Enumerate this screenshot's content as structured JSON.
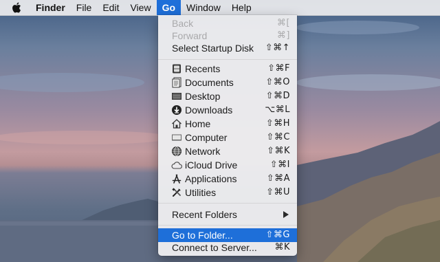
{
  "menubar": {
    "app_name": "Finder",
    "items": [
      "File",
      "Edit",
      "View",
      "Go",
      "Window",
      "Help"
    ],
    "active_item": "Go"
  },
  "go_menu": {
    "back": {
      "label": "Back",
      "shortcut": "⌘["
    },
    "forward": {
      "label": "Forward",
      "shortcut": "⌘]"
    },
    "startup": {
      "label": "Select Startup Disk",
      "shortcut": "⇧⌘↑"
    },
    "locations": [
      {
        "label": "Recents",
        "shortcut": "⇧⌘F",
        "icon": "recents-icon"
      },
      {
        "label": "Documents",
        "shortcut": "⇧⌘O",
        "icon": "documents-icon"
      },
      {
        "label": "Desktop",
        "shortcut": "⇧⌘D",
        "icon": "desktop-icon"
      },
      {
        "label": "Downloads",
        "shortcut": "⌥⌘L",
        "icon": "downloads-icon"
      },
      {
        "label": "Home",
        "shortcut": "⇧⌘H",
        "icon": "home-icon"
      },
      {
        "label": "Computer",
        "shortcut": "⇧⌘C",
        "icon": "computer-icon"
      },
      {
        "label": "Network",
        "shortcut": "⇧⌘K",
        "icon": "network-icon"
      },
      {
        "label": "iCloud Drive",
        "shortcut": "⇧⌘I",
        "icon": "icloud-icon"
      },
      {
        "label": "Applications",
        "shortcut": "⇧⌘A",
        "icon": "applications-icon"
      },
      {
        "label": "Utilities",
        "shortcut": "⇧⌘U",
        "icon": "utilities-icon"
      }
    ],
    "recent_folders": {
      "label": "Recent Folders"
    },
    "go_to_folder": {
      "label": "Go to Folder...",
      "shortcut": "⇧⌘G"
    },
    "connect_server": {
      "label": "Connect to Server...",
      "shortcut": "⌘K"
    }
  },
  "colors": {
    "highlight": "#1e6fd9",
    "disabled_text": "#a9a9ab"
  }
}
